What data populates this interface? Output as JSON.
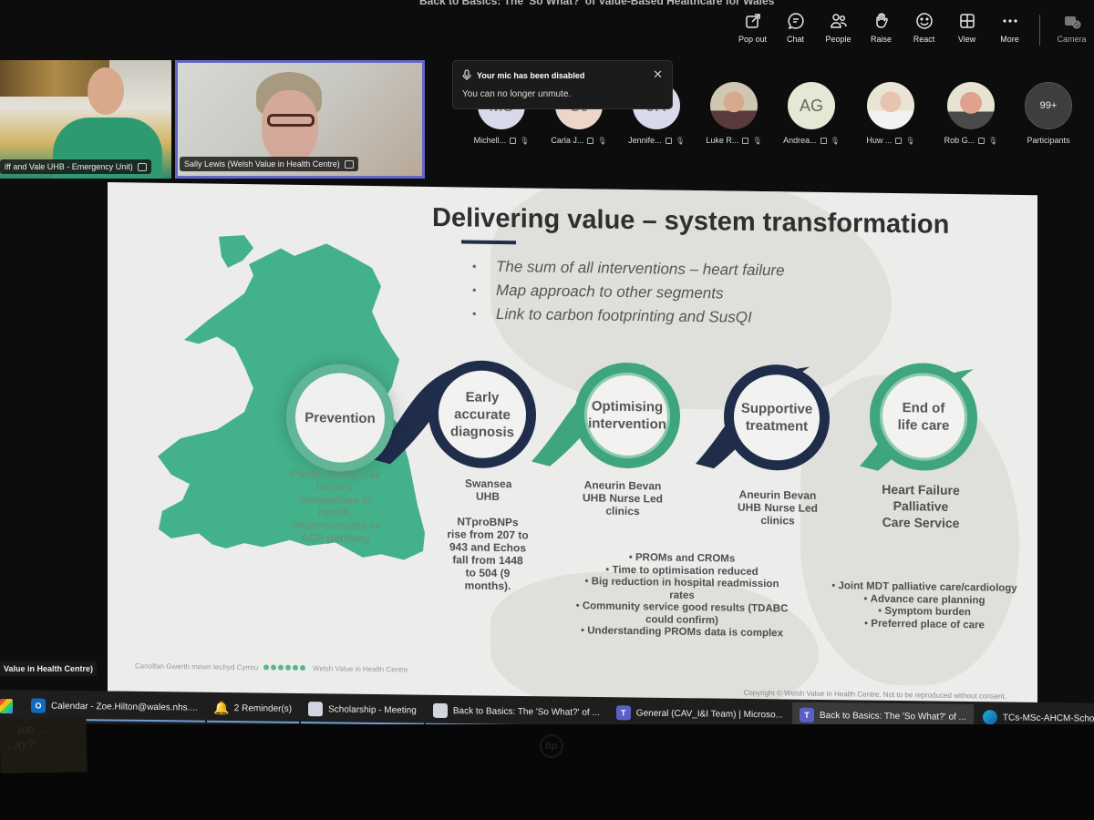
{
  "meeting": {
    "title": "Back to Basics: The 'So What?' of Value-Based Healthcare for Wales"
  },
  "toolbar": {
    "buttons": [
      {
        "label": "Pop out",
        "icon": "pop-out-icon"
      },
      {
        "label": "Chat",
        "icon": "chat-icon"
      },
      {
        "label": "People",
        "icon": "people-icon"
      },
      {
        "label": "Raise",
        "icon": "raise-hand-icon"
      },
      {
        "label": "React",
        "icon": "react-icon"
      },
      {
        "label": "View",
        "icon": "view-grid-icon"
      },
      {
        "label": "More",
        "icon": "more-icon"
      }
    ],
    "camera_label": "Camera"
  },
  "video_tiles": [
    {
      "label": "iff and Vale UHB - Emergency Unit)"
    },
    {
      "label": "Sally Lewis (Welsh Value in Health Centre)"
    }
  ],
  "notification": {
    "title": "Your mic has been disabled",
    "body": "You can no longer unmute.",
    "close": "✕"
  },
  "participants": [
    {
      "name": "Michell...",
      "initials": "MS",
      "color": "#d9d9ec"
    },
    {
      "name": "Carla J...",
      "initials": "CJ",
      "color": "#ecd6c9"
    },
    {
      "name": "Jennife...",
      "initials": "JR",
      "color": "#d9d9ec"
    },
    {
      "name": "Luke R...",
      "initials": "",
      "color": ""
    },
    {
      "name": "Andrea...",
      "initials": "AG",
      "color": "#e6e8d6"
    },
    {
      "name": "Huw ...",
      "initials": "",
      "color": ""
    },
    {
      "name": "Rob G...",
      "initials": "",
      "color": ""
    }
  ],
  "participants_more": {
    "count": "99+",
    "label": "Participants"
  },
  "slide": {
    "title": "Delivering value – system transformation",
    "bullets": [
      "The sum of all interventions – heart failure",
      "Map approach to other segments",
      "Link to carbon footprinting and SusQI"
    ],
    "stages": [
      {
        "label": "Prevention"
      },
      {
        "label": "Early accurate diagnosis"
      },
      {
        "label": "Optimising intervention"
      },
      {
        "label": "Supportive treatment"
      },
      {
        "label": "End of life care"
      }
    ],
    "prevention_text": "Public health risk factors, inequalities in health, improvements in ACS pathway",
    "diagnosis_text": {
      "org": "Swansea UHB",
      "detail": "NTproBNPs rise from 207 to 943 and Echos fall from 1448 to 504 (9 months)."
    },
    "optimising_text": "Aneurin Bevan UHB Nurse Led clinics",
    "supportive_text": "Aneurin Bevan UHB Nurse Led clinics",
    "optimising_bullets": [
      "PROMs and CROMs",
      "Time to optimisation reduced",
      "Big reduction in hospital readmission rates",
      "Community service good results (TDABC could confirm)",
      "Understanding PROMs data is complex"
    ],
    "eol_service": "Heart Failure Palliative Care Service",
    "eol_bullets": [
      "Joint MDT palliative care/cardiology",
      "Advance care planning",
      "Symptom burden",
      "Preferred place of care"
    ],
    "footer_welsh": "Canolfan Gwerth mewn Iechyd Cymru",
    "footer_english": "Welsh Value in Health Centre",
    "copyright": "Copyright © Welsh Value in Health Centre. Not to be reproduced without consent.",
    "colors": {
      "green": "#3fa57f",
      "navy": "#1f2d4b",
      "map": "#43b18a"
    }
  },
  "bottom_tile_label": "Value in Health Centre)",
  "taskbar": {
    "items": [
      {
        "label": "Calendar - Zoe.Hilton@wales.nhs....",
        "icon": "outlook-icon"
      },
      {
        "label": "2 Reminder(s)",
        "icon": "bell-icon"
      },
      {
        "label": "Scholarship - Meeting",
        "icon": "meeting-icon"
      },
      {
        "label": "Back to Basics: The 'So What?' of ...",
        "icon": "meeting-icon"
      },
      {
        "label": "General (CAV_I&I Team) | Microso...",
        "icon": "teams-icon"
      },
      {
        "label": "Back to Basics: The 'So What?' of ...",
        "icon": "teams-icon"
      },
      {
        "label": "TCs-MSc-AHCM-Schola",
        "icon": "edge-icon"
      }
    ]
  },
  "monitor_brand": "hp",
  "sticky_note": "... we ...\n...ay?"
}
